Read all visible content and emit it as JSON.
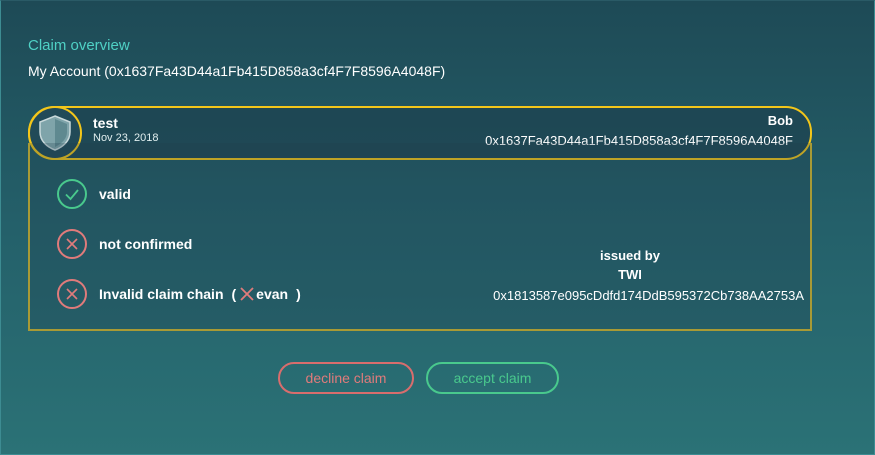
{
  "page": {
    "title": "Claim overview",
    "account": "My Account (0x1637Fa43D44a1Fb415D858a3cf4F7F8596A4048F)"
  },
  "claim": {
    "topic": "test",
    "date": "Nov 23, 2018",
    "subject_name": "Bob",
    "subject_address": "0x1637Fa43D44a1Fb415D858a3cf4F7F8596A4048F",
    "avatar_icon": "shield-icon"
  },
  "checks": [
    {
      "label": "valid",
      "status": "ok",
      "icon": "check-icon"
    },
    {
      "label": "not confirmed",
      "status": "error",
      "icon": "x-icon"
    },
    {
      "label": "Invalid claim chain",
      "status": "error",
      "icon": "x-icon"
    }
  ],
  "claim_chain": {
    "open": "(",
    "entry": "evan",
    "close": ")",
    "entry_icon": "x-icon"
  },
  "issuer": {
    "label": "issued by",
    "name": "TWI",
    "address": "0x1813587e095cDdfd174DdB595372Cb738AA2753A"
  },
  "actions": {
    "decline_label": "decline claim",
    "accept_label": "accept claim"
  },
  "colors": {
    "accent": "#4fd1c5",
    "highlight": "#f3c61a",
    "success": "#49c98d",
    "error": "#e07b7b"
  }
}
